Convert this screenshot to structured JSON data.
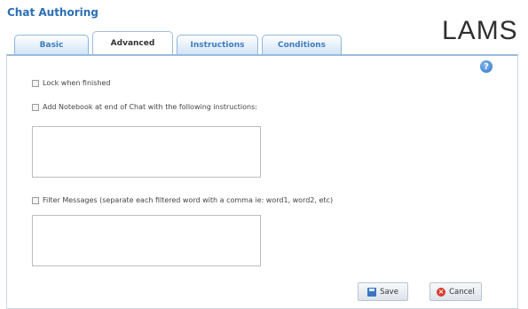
{
  "app": {
    "title": "Chat Authoring",
    "logo": "LAMS"
  },
  "tabs": [
    {
      "label": "Basic",
      "active": false
    },
    {
      "label": "Advanced",
      "active": true
    },
    {
      "label": "Instructions",
      "active": false
    },
    {
      "label": "Conditions",
      "active": false
    }
  ],
  "help": {
    "icon": "?"
  },
  "options": {
    "lock_when_finished": {
      "label": "Lock when finished",
      "checked": false
    },
    "add_notebook": {
      "label": "Add Notebook at end of Chat with the following instructions:",
      "checked": false
    },
    "notebook_instructions_value": "",
    "filter_messages": {
      "label": "Filter Messages (separate each filtered word with a comma ie: word1, word2, etc)",
      "checked": false
    },
    "filter_words_value": ""
  },
  "buttons": {
    "save": "Save",
    "cancel": "Cancel"
  },
  "colors": {
    "accent": "#2a6fb6",
    "tab_border": "#8fb6dd"
  }
}
